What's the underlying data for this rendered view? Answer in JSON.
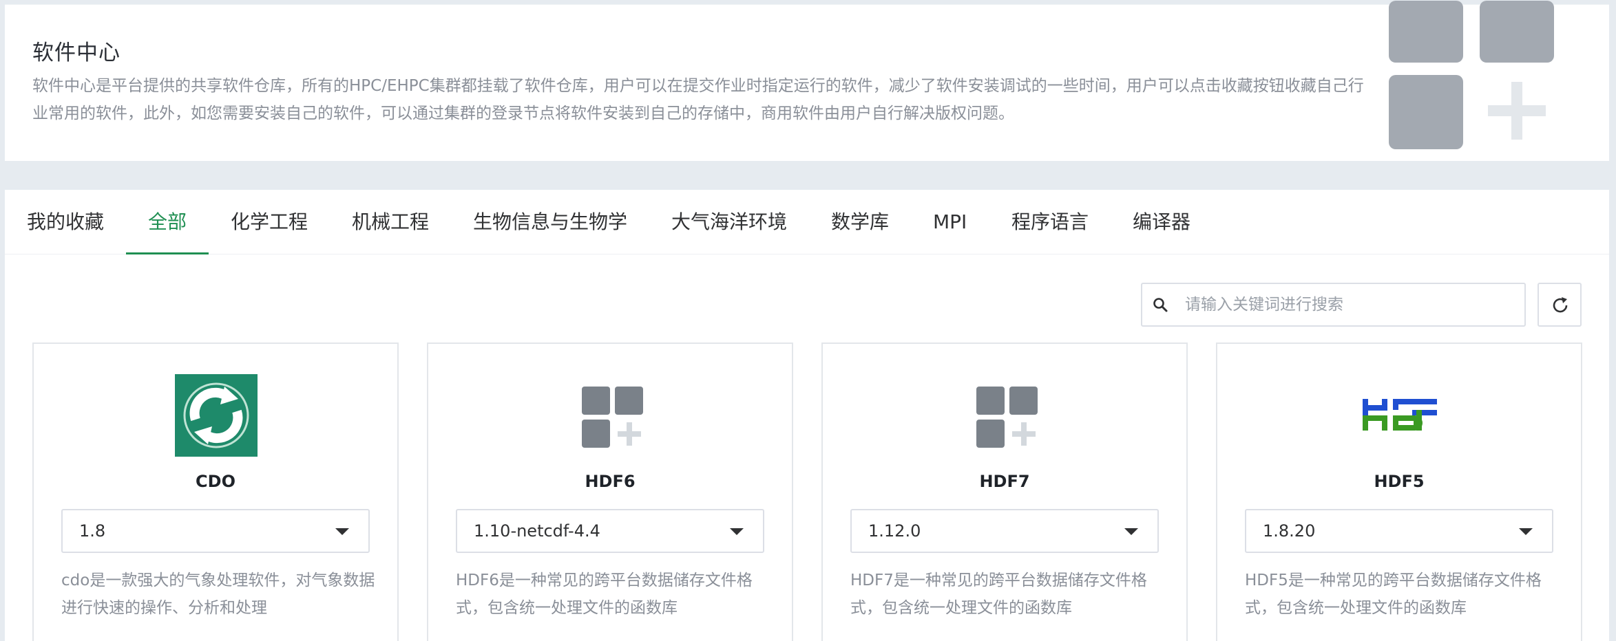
{
  "header": {
    "title": "软件中心",
    "description": "软件中心是平台提供的共享软件仓库，所有的HPC/EHPC集群都挂载了软件仓库，用户可以在提交作业时指定运行的软件，减少了软件安装调试的一些时间，用户可以点击收藏按钮收藏自己行业常用的软件，此外，如您需要安装自己的软件，可以通过集群的登录节点将软件安装到自己的存储中，商用软件由用户自行解决版权问题。",
    "art_icon": "apps-plus-icon"
  },
  "tabs": [
    {
      "label": "我的收藏",
      "active": false
    },
    {
      "label": "全部",
      "active": true
    },
    {
      "label": "化学工程",
      "active": false
    },
    {
      "label": "机械工程",
      "active": false
    },
    {
      "label": "生物信息与生物学",
      "active": false
    },
    {
      "label": "大气海洋环境",
      "active": false
    },
    {
      "label": "数学库",
      "active": false
    },
    {
      "label": "MPI",
      "active": false
    },
    {
      "label": "程序语言",
      "active": false
    },
    {
      "label": "编译器",
      "active": false
    }
  ],
  "search": {
    "placeholder": "请输入关键词进行搜索",
    "value": "",
    "icon": "search-icon"
  },
  "refresh": {
    "icon": "refresh-icon"
  },
  "software": [
    {
      "name": "CDO",
      "version": "1.8",
      "logo": "cdo-logo",
      "description": "cdo是一款强大的气象处理软件，对气象数据进行快速的操作、分析和处理"
    },
    {
      "name": "HDF6",
      "version": "1.10-netcdf-4.4",
      "logo": "apps-plus-icon",
      "description": "HDF6是一种常见的跨平台数据储存文件格式，包含统一处理文件的函数库"
    },
    {
      "name": "HDF7",
      "version": "1.12.0",
      "logo": "apps-plus-icon",
      "description": "HDF7是一种常见的跨平台数据储存文件格式，包含统一处理文件的函数库"
    },
    {
      "name": "HDF5",
      "version": "1.8.20",
      "logo": "hdf-logo",
      "description": "HDF5是一种常见的跨平台数据储存文件格式，包含统一处理文件的函数库"
    }
  ],
  "colors": {
    "accent": "#1f8f52",
    "placeholder_icon": "#7a8189",
    "placeholder_plus": "#d3d8dd",
    "cdo_green": "#1e8a6a",
    "hdf_blue": "#1f4fd1",
    "hdf_green": "#3a9a23"
  }
}
